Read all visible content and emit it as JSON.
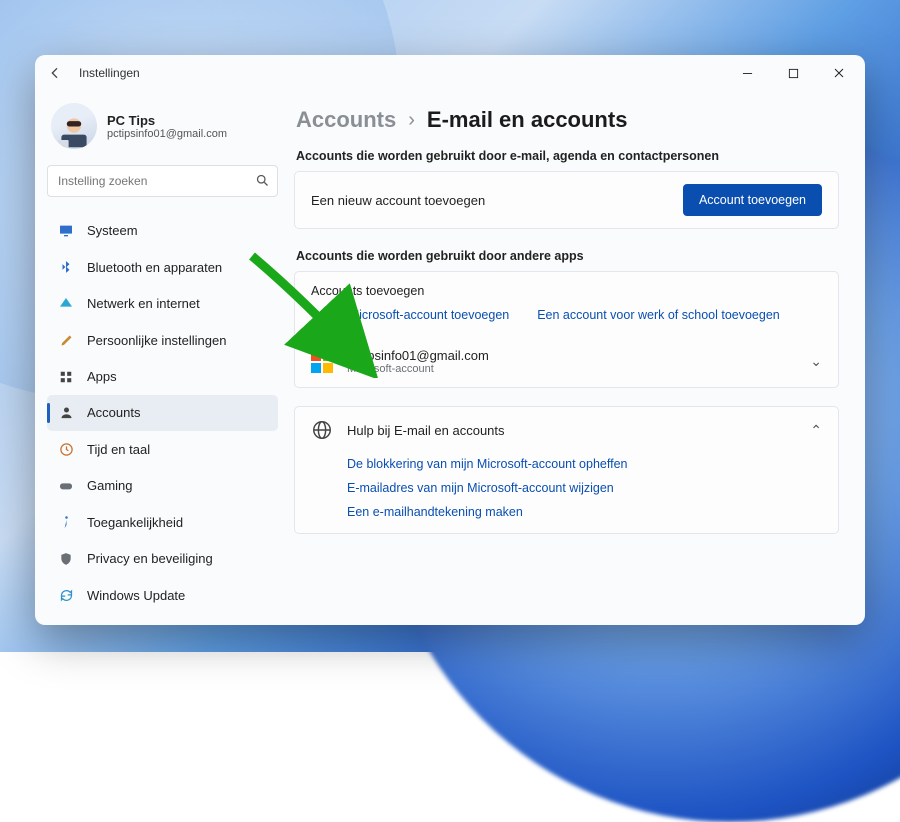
{
  "titlebar": {
    "title": "Instellingen"
  },
  "profile": {
    "name": "PC Tips",
    "email": "pctipsinfo01@gmail.com"
  },
  "search": {
    "placeholder": "Instelling zoeken"
  },
  "sidebar": {
    "items": [
      {
        "icon": "monitor",
        "color": "#2f6fc9",
        "label": "Systeem"
      },
      {
        "icon": "bluetooth",
        "color": "#2f6fc9",
        "label": "Bluetooth en apparaten"
      },
      {
        "icon": "wifi",
        "color": "#2aa7d3",
        "label": "Netwerk en internet"
      },
      {
        "icon": "brush",
        "color": "#c98b2f",
        "label": "Persoonlijke instellingen"
      },
      {
        "icon": "apps",
        "color": "#444",
        "label": "Apps"
      },
      {
        "icon": "person",
        "color": "#444",
        "label": "Accounts",
        "active": true
      },
      {
        "icon": "clock",
        "color": "#c9702f",
        "label": "Tijd en taal"
      },
      {
        "icon": "gamepad",
        "color": "#6a6f76",
        "label": "Gaming"
      },
      {
        "icon": "accessibility",
        "color": "#2f6fc9",
        "label": "Toegankelijkheid"
      },
      {
        "icon": "shield",
        "color": "#6a6f76",
        "label": "Privacy en beveiliging"
      },
      {
        "icon": "update",
        "color": "#2f8fc9",
        "label": "Windows Update"
      }
    ]
  },
  "breadcrumb": {
    "root": "Accounts",
    "leaf": "E-mail en accounts"
  },
  "sections": {
    "email_section": {
      "heading": "Accounts die worden gebruikt door e-mail, agenda en contactpersonen",
      "add_label": "Een nieuw account toevoegen",
      "add_button": "Account toevoegen"
    },
    "other_section": {
      "heading": "Accounts die worden gebruikt door andere apps",
      "subheading": "Accounts toevoegen",
      "link_ms": "Een Microsoft-account toevoegen",
      "link_work": "Een account voor werk of school toevoegen",
      "account_email": "pctipsinfo01@gmail.com",
      "account_type": "Microsoft-account"
    },
    "help": {
      "heading": "Hulp bij E-mail en accounts",
      "links": [
        "De blokkering van mijn Microsoft-account opheffen",
        "E-mailadres van mijn Microsoft-account wijzigen",
        "Een e-mailhandtekening maken"
      ]
    }
  },
  "colors": {
    "accent": "#0a4fb0",
    "arrow": "#1aa81a"
  }
}
